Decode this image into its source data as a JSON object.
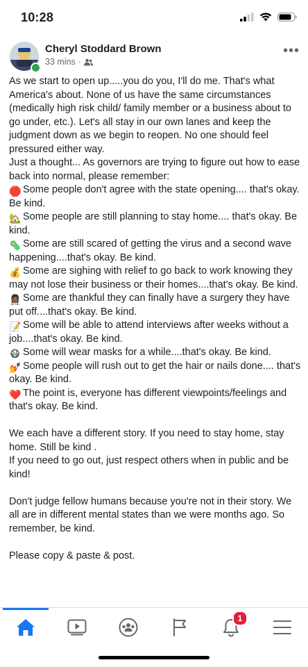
{
  "status_bar": {
    "time": "10:28"
  },
  "post": {
    "author": "Cheryl Stoddard Brown",
    "timestamp": "33 mins",
    "meta_separator": "·",
    "audience_icon": "friends-icon",
    "lines": [
      "As we start to open up.....you do you, I'll do me. That's what America's about. None of us have the same circumstances (medically high risk child/ family member or a business about to go under, etc.). Let's all stay in our own lanes and keep the judgment down as we begin to reopen. No one should feel pressured either way.",
      "Just a thought... As governors are trying to figure out how to ease back into normal, please remember:"
    ],
    "items": [
      {
        "emoji": "🛑",
        "text": "Some people don't agree with the state opening.... that's okay. Be kind."
      },
      {
        "emoji": "🏡",
        "text": "Some people are still planning to stay home.... that's okay. Be kind."
      },
      {
        "emoji": "🦠",
        "text": "Some are still scared of getting the virus and a second wave happening....that's okay. Be kind."
      },
      {
        "emoji": "💰",
        "text": "Some are sighing with relief to go back to work knowing they may not lose their business or their homes....that's okay. Be kind."
      },
      {
        "emoji": "👩🏾‍⚕️",
        "text": "Some are thankful they can finally have a surgery they have put off....that's okay. Be kind."
      },
      {
        "emoji": "📝",
        "text": "Some will be able to attend interviews after weeks without a job....that's okay. Be kind."
      },
      {
        "emoji": "😷",
        "text": "Some will wear masks for a while....that's okay. Be kind."
      },
      {
        "emoji": "💅",
        "text": "Some people will rush out to get the hair or nails done.... that's okay. Be kind."
      },
      {
        "emoji": "❤️",
        "text": "The point is, everyone has different viewpoints/feelings and that's okay. Be kind."
      }
    ],
    "para2_a": "We each have a different story. If you need to stay home, stay home. Still be kind .",
    "para2_b": "If you need to go out, just respect others when in public and be kind!",
    "para3": "Don't judge fellow humans because you're not in their story. We all are in different mental states than we were months ago. So remember, be kind.",
    "para4": "Please copy & paste & post."
  },
  "nav": {
    "items": [
      "home-icon",
      "watch-icon",
      "groups-icon",
      "pages-flag-icon",
      "notifications-bell-icon",
      "menu-icon"
    ],
    "notification_count": "1",
    "active_color": "#1877f2"
  }
}
